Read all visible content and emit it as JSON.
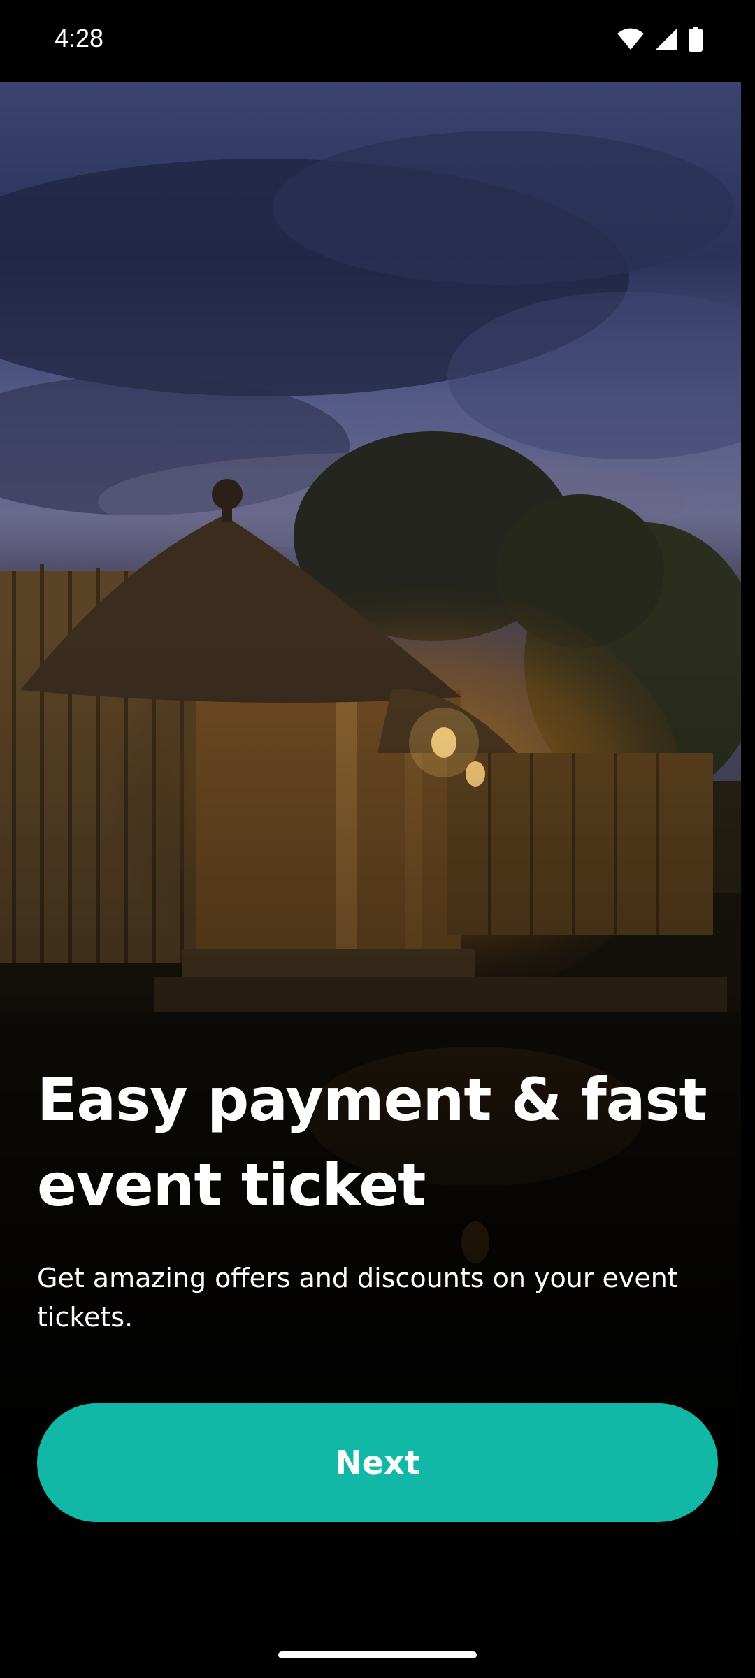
{
  "status_bar": {
    "time": "4:28",
    "icons": [
      "wifi-icon",
      "signal-icon",
      "battery-icon"
    ]
  },
  "hero": {
    "image": "thatched-hut-at-dusk"
  },
  "onboarding": {
    "headline": "Easy payment & fast event ticket",
    "subtext": "Get amazing offers and discounts on your event tickets.",
    "next_label": "Next"
  },
  "colors": {
    "accent": "#12b8a6",
    "background": "#000000",
    "text": "#ffffff"
  }
}
